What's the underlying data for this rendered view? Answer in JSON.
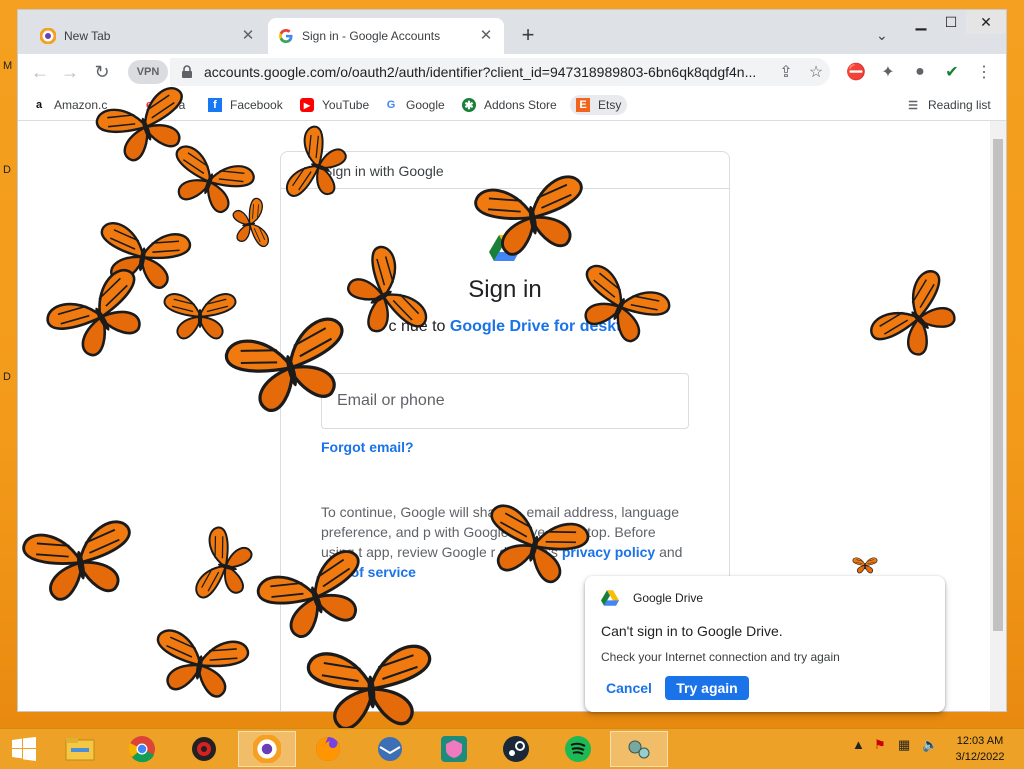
{
  "browser": {
    "tabs": [
      {
        "title": "New Tab"
      },
      {
        "title": "Sign in - Google Accounts"
      }
    ],
    "toolbar": {
      "vpn_label": "VPN",
      "url": "accounts.google.com/o/oauth2/auth/identifier?client_id=947318989803-6bn6qk8qdgf4n..."
    },
    "bookmarks": [
      {
        "label": "Amazon.c"
      },
      {
        "label": "eBa"
      },
      {
        "label": "Facebook"
      },
      {
        "label": "YouTube"
      },
      {
        "label": "Google"
      },
      {
        "label": "Addons Store"
      },
      {
        "label": "Etsy"
      }
    ],
    "reading_list": "Reading list"
  },
  "signin": {
    "header": "Sign in with Google",
    "title": "Sign in",
    "continue_prefix": "c  nue to",
    "continue_link": "Google Drive for deskt",
    "email_placeholder": "Email or phone",
    "forgot_email": "Forgot email?",
    "body_text": "To continue, Google will sha        me, email address, language preference, and p             with Google Drive r desktop. Before using t     app,           review Google r desktop's",
    "privacy_link": "privacy policy",
    "and_text": "and",
    "terms_link": "rms of service"
  },
  "toast": {
    "app": "Google Drive",
    "title": "Can't sign in to Google Drive.",
    "message": "Check your Internet connection and try again",
    "cancel": "Cancel",
    "retry": "Try again"
  },
  "desktop": {
    "letters": [
      "M",
      "D",
      "D"
    ]
  },
  "clock": {
    "time": "12:03 AM",
    "date": "3/12/2022"
  },
  "colors": {
    "accent": "#1a73e8",
    "desktop": "#f5a020",
    "butterfly": "#f07a10"
  }
}
